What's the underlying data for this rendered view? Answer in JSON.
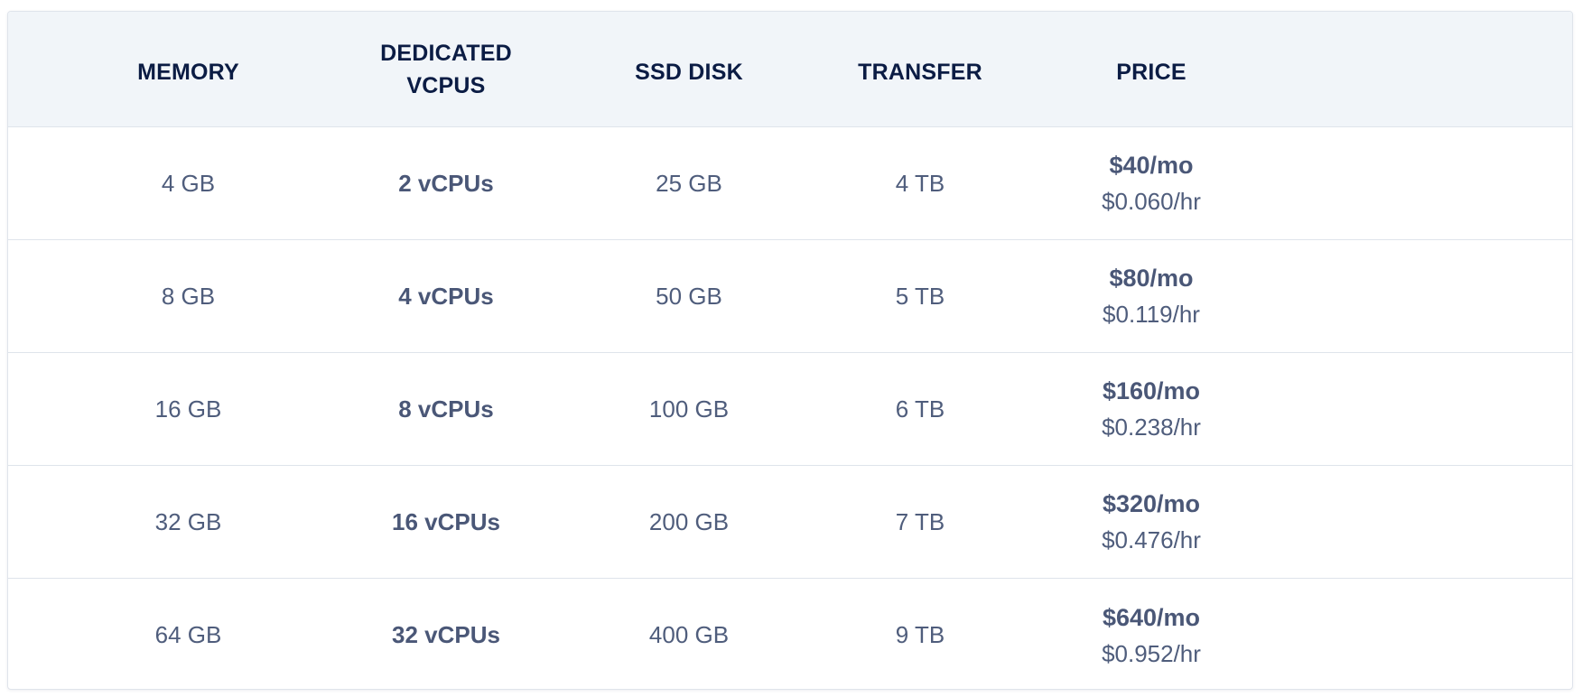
{
  "table": {
    "headers": {
      "memory": "MEMORY",
      "vcpus_line1": "DEDICATED",
      "vcpus_line2": "VCPUS",
      "ssd": "SSD DISK",
      "transfer": "TRANSFER",
      "price": "PRICE"
    },
    "rows": [
      {
        "memory": "4 GB",
        "vcpus": "2 vCPUs",
        "ssd": "25 GB",
        "transfer": "4 TB",
        "price_mo": "$40/mo",
        "price_hr": "$0.060/hr"
      },
      {
        "memory": "8 GB",
        "vcpus": "4 vCPUs",
        "ssd": "50 GB",
        "transfer": "5 TB",
        "price_mo": "$80/mo",
        "price_hr": "$0.119/hr"
      },
      {
        "memory": "16 GB",
        "vcpus": "8 vCPUs",
        "ssd": "100 GB",
        "transfer": "6 TB",
        "price_mo": "$160/mo",
        "price_hr": "$0.238/hr"
      },
      {
        "memory": "32 GB",
        "vcpus": "16 vCPUs",
        "ssd": "200 GB",
        "transfer": "7 TB",
        "price_mo": "$320/mo",
        "price_hr": "$0.476/hr"
      },
      {
        "memory": "64 GB",
        "vcpus": "32 vCPUs",
        "ssd": "400 GB",
        "transfer": "9 TB",
        "price_mo": "$640/mo",
        "price_hr": "$0.952/hr"
      }
    ]
  },
  "colors": {
    "header_bg": "#f1f5f9",
    "header_text": "#0b1c44",
    "body_text": "#4f5d7c",
    "border": "#dfe4eb"
  }
}
